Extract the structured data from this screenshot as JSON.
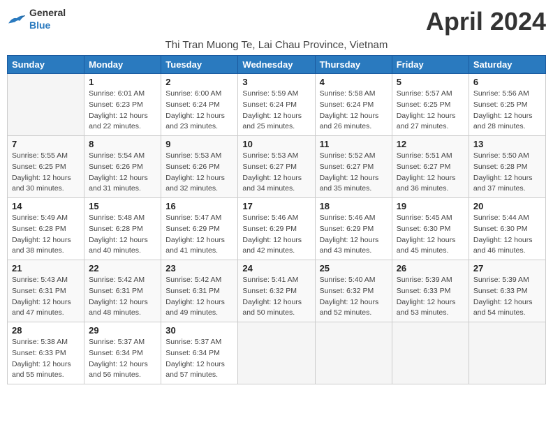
{
  "header": {
    "logo_general": "General",
    "logo_blue": "Blue",
    "title": "April 2024",
    "subtitle": "Thi Tran Muong Te, Lai Chau Province, Vietnam"
  },
  "days_of_week": [
    "Sunday",
    "Monday",
    "Tuesday",
    "Wednesday",
    "Thursday",
    "Friday",
    "Saturday"
  ],
  "weeks": [
    [
      {
        "day": "",
        "sunrise": "",
        "sunset": "",
        "daylight": ""
      },
      {
        "day": "1",
        "sunrise": "Sunrise: 6:01 AM",
        "sunset": "Sunset: 6:23 PM",
        "daylight": "Daylight: 12 hours and 22 minutes."
      },
      {
        "day": "2",
        "sunrise": "Sunrise: 6:00 AM",
        "sunset": "Sunset: 6:24 PM",
        "daylight": "Daylight: 12 hours and 23 minutes."
      },
      {
        "day": "3",
        "sunrise": "Sunrise: 5:59 AM",
        "sunset": "Sunset: 6:24 PM",
        "daylight": "Daylight: 12 hours and 25 minutes."
      },
      {
        "day": "4",
        "sunrise": "Sunrise: 5:58 AM",
        "sunset": "Sunset: 6:24 PM",
        "daylight": "Daylight: 12 hours and 26 minutes."
      },
      {
        "day": "5",
        "sunrise": "Sunrise: 5:57 AM",
        "sunset": "Sunset: 6:25 PM",
        "daylight": "Daylight: 12 hours and 27 minutes."
      },
      {
        "day": "6",
        "sunrise": "Sunrise: 5:56 AM",
        "sunset": "Sunset: 6:25 PM",
        "daylight": "Daylight: 12 hours and 28 minutes."
      }
    ],
    [
      {
        "day": "7",
        "sunrise": "Sunrise: 5:55 AM",
        "sunset": "Sunset: 6:25 PM",
        "daylight": "Daylight: 12 hours and 30 minutes."
      },
      {
        "day": "8",
        "sunrise": "Sunrise: 5:54 AM",
        "sunset": "Sunset: 6:26 PM",
        "daylight": "Daylight: 12 hours and 31 minutes."
      },
      {
        "day": "9",
        "sunrise": "Sunrise: 5:53 AM",
        "sunset": "Sunset: 6:26 PM",
        "daylight": "Daylight: 12 hours and 32 minutes."
      },
      {
        "day": "10",
        "sunrise": "Sunrise: 5:53 AM",
        "sunset": "Sunset: 6:27 PM",
        "daylight": "Daylight: 12 hours and 34 minutes."
      },
      {
        "day": "11",
        "sunrise": "Sunrise: 5:52 AM",
        "sunset": "Sunset: 6:27 PM",
        "daylight": "Daylight: 12 hours and 35 minutes."
      },
      {
        "day": "12",
        "sunrise": "Sunrise: 5:51 AM",
        "sunset": "Sunset: 6:27 PM",
        "daylight": "Daylight: 12 hours and 36 minutes."
      },
      {
        "day": "13",
        "sunrise": "Sunrise: 5:50 AM",
        "sunset": "Sunset: 6:28 PM",
        "daylight": "Daylight: 12 hours and 37 minutes."
      }
    ],
    [
      {
        "day": "14",
        "sunrise": "Sunrise: 5:49 AM",
        "sunset": "Sunset: 6:28 PM",
        "daylight": "Daylight: 12 hours and 38 minutes."
      },
      {
        "day": "15",
        "sunrise": "Sunrise: 5:48 AM",
        "sunset": "Sunset: 6:28 PM",
        "daylight": "Daylight: 12 hours and 40 minutes."
      },
      {
        "day": "16",
        "sunrise": "Sunrise: 5:47 AM",
        "sunset": "Sunset: 6:29 PM",
        "daylight": "Daylight: 12 hours and 41 minutes."
      },
      {
        "day": "17",
        "sunrise": "Sunrise: 5:46 AM",
        "sunset": "Sunset: 6:29 PM",
        "daylight": "Daylight: 12 hours and 42 minutes."
      },
      {
        "day": "18",
        "sunrise": "Sunrise: 5:46 AM",
        "sunset": "Sunset: 6:29 PM",
        "daylight": "Daylight: 12 hours and 43 minutes."
      },
      {
        "day": "19",
        "sunrise": "Sunrise: 5:45 AM",
        "sunset": "Sunset: 6:30 PM",
        "daylight": "Daylight: 12 hours and 45 minutes."
      },
      {
        "day": "20",
        "sunrise": "Sunrise: 5:44 AM",
        "sunset": "Sunset: 6:30 PM",
        "daylight": "Daylight: 12 hours and 46 minutes."
      }
    ],
    [
      {
        "day": "21",
        "sunrise": "Sunrise: 5:43 AM",
        "sunset": "Sunset: 6:31 PM",
        "daylight": "Daylight: 12 hours and 47 minutes."
      },
      {
        "day": "22",
        "sunrise": "Sunrise: 5:42 AM",
        "sunset": "Sunset: 6:31 PM",
        "daylight": "Daylight: 12 hours and 48 minutes."
      },
      {
        "day": "23",
        "sunrise": "Sunrise: 5:42 AM",
        "sunset": "Sunset: 6:31 PM",
        "daylight": "Daylight: 12 hours and 49 minutes."
      },
      {
        "day": "24",
        "sunrise": "Sunrise: 5:41 AM",
        "sunset": "Sunset: 6:32 PM",
        "daylight": "Daylight: 12 hours and 50 minutes."
      },
      {
        "day": "25",
        "sunrise": "Sunrise: 5:40 AM",
        "sunset": "Sunset: 6:32 PM",
        "daylight": "Daylight: 12 hours and 52 minutes."
      },
      {
        "day": "26",
        "sunrise": "Sunrise: 5:39 AM",
        "sunset": "Sunset: 6:33 PM",
        "daylight": "Daylight: 12 hours and 53 minutes."
      },
      {
        "day": "27",
        "sunrise": "Sunrise: 5:39 AM",
        "sunset": "Sunset: 6:33 PM",
        "daylight": "Daylight: 12 hours and 54 minutes."
      }
    ],
    [
      {
        "day": "28",
        "sunrise": "Sunrise: 5:38 AM",
        "sunset": "Sunset: 6:33 PM",
        "daylight": "Daylight: 12 hours and 55 minutes."
      },
      {
        "day": "29",
        "sunrise": "Sunrise: 5:37 AM",
        "sunset": "Sunset: 6:34 PM",
        "daylight": "Daylight: 12 hours and 56 minutes."
      },
      {
        "day": "30",
        "sunrise": "Sunrise: 5:37 AM",
        "sunset": "Sunset: 6:34 PM",
        "daylight": "Daylight: 12 hours and 57 minutes."
      },
      {
        "day": "",
        "sunrise": "",
        "sunset": "",
        "daylight": ""
      },
      {
        "day": "",
        "sunrise": "",
        "sunset": "",
        "daylight": ""
      },
      {
        "day": "",
        "sunrise": "",
        "sunset": "",
        "daylight": ""
      },
      {
        "day": "",
        "sunrise": "",
        "sunset": "",
        "daylight": ""
      }
    ]
  ]
}
